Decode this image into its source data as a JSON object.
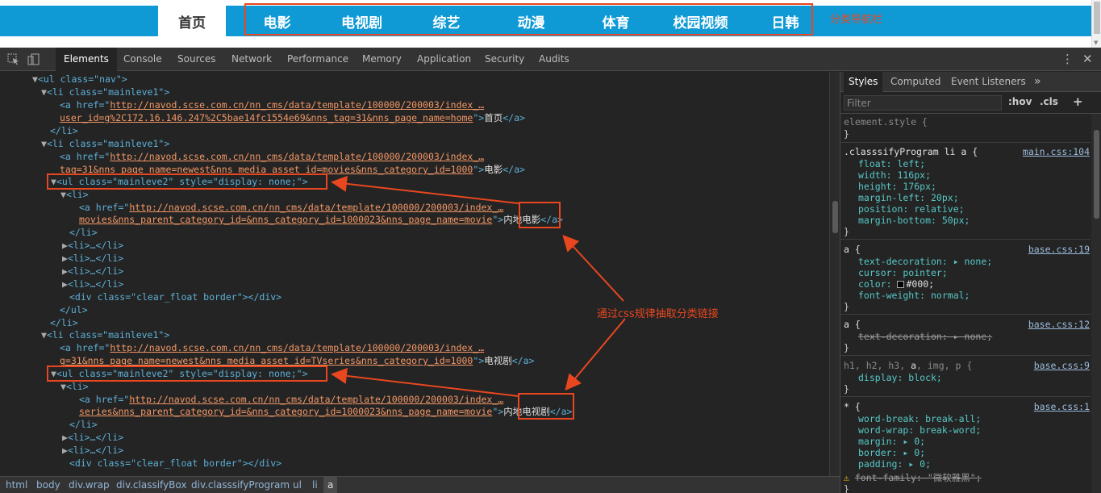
{
  "page_nav": {
    "home": "首页",
    "items": [
      "电影",
      "电视剧",
      "综艺",
      "动漫",
      "体育",
      "校园视频",
      "日韩"
    ],
    "annotation": "分类导航栏"
  },
  "devtools": {
    "tabs": [
      "Elements",
      "Console",
      "Sources",
      "Network",
      "Performance",
      "Memory",
      "Application",
      "Security",
      "Audits"
    ],
    "active_tab": "Elements",
    "icons": [
      "inspect-icon",
      "device-toggle-icon",
      "more-vert-icon",
      "close-icon"
    ]
  },
  "dom": {
    "l1": "<ul class=\"nav\">",
    "l2": "<li class=\"mainleve1\">",
    "l3_pre": "<a href=\"",
    "l3_link": "http://navod.scse.com.cn/nn_cms/data/template/100000/200003/index_…",
    "l4_link": "user_id=g%2C172.16.146.247%2C5bae14fc1554e69&nns_tag=31&nns_page_name=home",
    "l4_text": "首页",
    "l5": "</li>",
    "l6": "<li class=\"mainleve1\">",
    "l7_pre": "<a href=\"",
    "l7_link": "http://navod.scse.com.cn/nn_cms/data/template/100000/200003/index_…",
    "l8_link": "tag=31&nns_page_name=newest&nns_media_asset_id=movies&nns_category_id=1000",
    "l8_text": "电影",
    "l9": "<ul class=\"mainleve2\" style=\"display: none;\">",
    "l10": "<li>",
    "l11_pre": "<a href=\"",
    "l11_link": "http://navod.scse.com.cn/nn_cms/data/template/100000/200003/index_…",
    "l12_link": "movies&nns_parent_category_id=&nns_category_id=1000023&nns_page_name=movie",
    "l12_text": "内地电影",
    "l13": "</li>",
    "l14": "<li>…</li>",
    "l15": "<li>…</li>",
    "l16": "<li>…</li>",
    "l17": "<li>…</li>",
    "l18": "<div class=\"clear_float border\"></div>",
    "l19": "</ul>",
    "l20": "</li>",
    "l21": "<li class=\"mainleve1\">",
    "l22_pre": "<a href=\"",
    "l22_link": "http://navod.scse.com.cn/nn_cms/data/template/100000/200003/index_…",
    "l23_link": "g=31&nns_page_name=newest&nns_media_asset_id=TVseries&nns_category_id=1000",
    "l23_text": "电视剧",
    "l24": "<ul class=\"mainleve2\" style=\"display: none;\">",
    "l25": "<li>",
    "l26_pre": "<a href=\"",
    "l26_link": "http://navod.scse.com.cn/nn_cms/data/template/100000/200003/index_…",
    "l27_link": "series&nns_parent_category_id=&nns_category_id=1000023&nns_page_name=movie",
    "l27_text": "内地电视剧",
    "l28": "</li>",
    "l29": "<li>…</li>",
    "l30": "<li>…</li>",
    "l31": "<div class=\"clear_float border\"></div>",
    "annotation": "通过css规律抽取分类链接"
  },
  "breadcrumb": [
    "html",
    "body",
    "div.wrap",
    "div.classifyBox",
    "div.classsifyProgram",
    "ul",
    "li",
    "a"
  ],
  "styles": {
    "tabs": [
      "Styles",
      "Computed",
      "Event Listeners"
    ],
    "more": "»",
    "filter_placeholder": "Filter",
    "hov": ":hov",
    "cls": ".cls",
    "plus": "+",
    "element_style": "element.style {",
    "close": "}",
    "r1_sel": ".classsifyProgram li a {",
    "r1_src": "main.css:104",
    "r1_props": [
      "float: left;",
      "width: 116px;",
      "height: 176px;",
      "margin-left: 20px;",
      "position: relative;",
      "margin-bottom: 50px;"
    ],
    "r2_sel": "a {",
    "r2_src": "base.css:19",
    "r2_p1": "text-decoration: ▸ none;",
    "r2_p2": "cursor: pointer;",
    "r2_p3": "color: ",
    "r2_p3v": "#000;",
    "r2_p4": "font-weight: normal;",
    "r3_sel": "a {",
    "r3_src": "base.css:12",
    "r3_p1": "text-decoration: ▸ none;",
    "r4_sel_a": "h1, h2, h3, ",
    "r4_sel_b": "a",
    "r4_sel_c": ", img, p {",
    "r4_src": "base.css:9",
    "r4_p1": "display: block;",
    "r5_sel": "* {",
    "r5_src": "base.css:1",
    "r5_props": [
      "word-break: break-all;",
      "word-wrap: break-word;",
      "margin: ▸ 0;",
      "border: ▸ 0;",
      "padding: ▸ 0;"
    ],
    "r5_warn": "font-family: \"微软雅黑\";"
  },
  "colors": {
    "nav_blue": "#0f9ad6",
    "annotation_red": "#e8471f"
  }
}
